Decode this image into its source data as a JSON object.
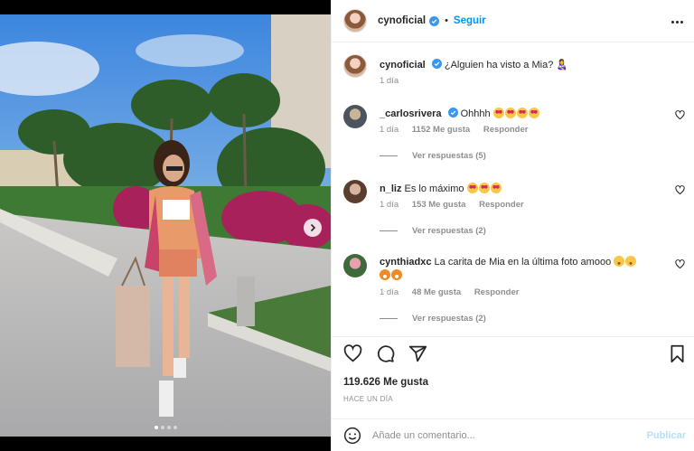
{
  "post": {
    "author": "cynoficial",
    "follow_label": "Seguir",
    "separator": "•",
    "caption_text": "¿Alguien ha visto a Mia?",
    "caption_emoji": "👩‍🍼",
    "caption_age": "1 día"
  },
  "comments": [
    {
      "username": "_carlosrivera",
      "text": "Ohhhh",
      "emoji": [
        "heart-eyes-emoji",
        "heart-eyes-emoji",
        "heart-eyes-emoji",
        "heart-eyes-emoji"
      ],
      "age": "1 día",
      "likes": "1152 Me gusta",
      "reply_label": "Responder",
      "view_replies": "Ver respuestas (5)"
    },
    {
      "username": "n_liz",
      "text": "Es lo máximo",
      "emoji": [
        "heart-eyes-emoji",
        "heart-eyes-emoji",
        "heart-eyes-emoji"
      ],
      "age": "1 día",
      "likes": "153 Me gusta",
      "reply_label": "Responder",
      "view_replies": "Ver respuestas (2)"
    },
    {
      "username": "cynthiadxc",
      "text": "La carita de Mia en la última foto amooo",
      "emoji": [
        "smiling-tear-emoji",
        "smiling-tear-emoji",
        "tiger-face-emoji",
        "tiger-face-emoji"
      ],
      "age": "1 día",
      "likes": "48 Me gusta",
      "reply_label": "Responder",
      "view_replies": "Ver respuestas (2)"
    }
  ],
  "actions": {
    "likes_count": "119.626 Me gusta",
    "posted_time": "HACE UN DÍA",
    "comment_placeholder": "Añade un comentario...",
    "publish_label": "Publicar"
  },
  "carousel": {
    "slide_count": 4,
    "active_slide": 1
  },
  "colors": {
    "link_blue": "#0095f6",
    "verified_blue": "#3897f0",
    "muted_text": "#8e8e8e",
    "publish_disabled": "#b2dffc"
  },
  "icons": [
    "verified-badge-icon",
    "more-options-icon",
    "heart-icon",
    "comment-icon",
    "share-icon",
    "bookmark-icon",
    "emoji-picker-icon",
    "carousel-next-icon"
  ]
}
